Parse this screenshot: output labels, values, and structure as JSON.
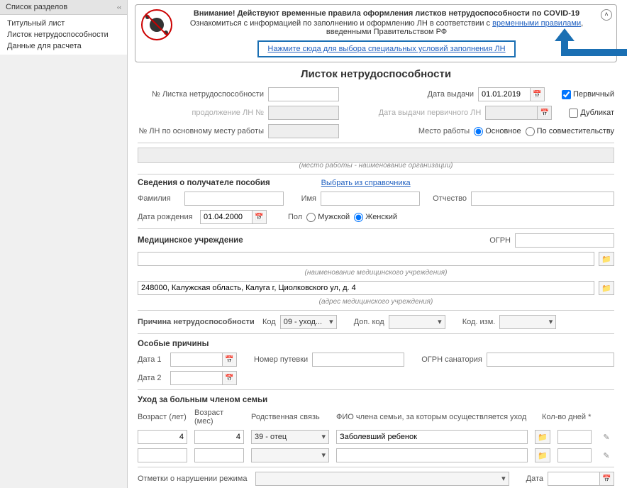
{
  "sidebar": {
    "title": "Список разделов",
    "items": [
      "Титульный лист",
      "Листок нетрудоспособности",
      "Данные для расчета"
    ]
  },
  "notice": {
    "title": "Внимание! Действуют временные правила оформления листков нетрудоспособности по COVID-19",
    "body_prefix": "Ознакомиться с информацией по заполнению и оформлению ЛН в соответствии с ",
    "link1": "временными правилами",
    "body_mid": ", введенными Правительством РФ",
    "special_link": "Нажмите сюда для выбора специальных условий заполнения ЛН"
  },
  "page_title": "Листок нетрудоспособности",
  "ln_number_label": "№ Листка нетрудоспособности",
  "issue_date_label": "Дата выдачи",
  "issue_date_value": "01.01.2019",
  "primary_label": "Первичный",
  "duplicate_label": "Дубликат",
  "continuation_label": "продолжение ЛН №",
  "primary_date_label": "Дата выдачи первичного ЛН",
  "main_place_label": "№ ЛН по основному месту работы",
  "workplace_label": "Место работы",
  "workplace_main": "Основное",
  "workplace_combi": "По совместительству",
  "org_hint": "(место работы - наименование организации)",
  "recipient_section": "Сведения о получателе пособия",
  "from_ref_link": "Выбрать из справочника",
  "lastname_label": "Фамилия",
  "firstname_label": "Имя",
  "patronymic_label": "Отчество",
  "birthdate_label": "Дата рождения",
  "birthdate_value": "01.04.2000",
  "sex_label": "Пол",
  "sex_m": "Мужской",
  "sex_f": "Женский",
  "med_section": "Медицинское учреждение",
  "ogrn_label": "ОГРН",
  "med_name_hint": "(наименование медицинского учреждения)",
  "med_addr_value": "248000, Калужская область, Калуга г, Циолковского ул, д. 4",
  "med_addr_hint": "(адрес медицинского учреждения)",
  "reason_label": "Причина нетрудоспособности",
  "code_label": "Код",
  "code_value": "09 - уход...",
  "add_code_label": "Доп. код",
  "code_change_label": "Код. изм.",
  "special_reasons": "Особые причины",
  "date1_label": "Дата 1",
  "date2_label": "Дата 2",
  "voucher_label": "Номер путевки",
  "sanatorium_ogrn_label": "ОГРН санатория",
  "care_section": "Уход за больным членом семьи",
  "age_years_label": "Возраст (лет)",
  "age_years_value": "4",
  "age_months_label": "Возраст (мес)",
  "age_months_value": "4",
  "relation_label": "Родственная связь",
  "relation_value": "39 - отец",
  "fio_label": "ФИО члена семьи, за которым осуществляется уход",
  "fio_value": "Заболевший ребенок",
  "days_label": "Кол-во дней *",
  "violation_label": "Отметки о нарушении режима",
  "violation_date_label": "Дата"
}
